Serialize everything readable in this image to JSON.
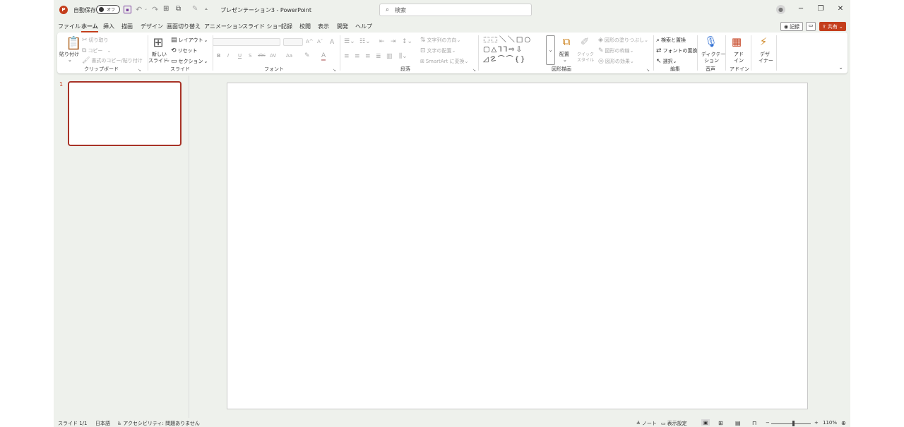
{
  "titlebar": {
    "autosave_label": "自動保存",
    "autosave_state": "オフ",
    "doc_title": "プレゼンテーション3 - PowerPoint",
    "search_placeholder": "検索",
    "minimize": "─",
    "restore": "❐",
    "close": "✕"
  },
  "tabs": [
    "ファイル",
    "ホーム",
    "挿入",
    "描画",
    "デザイン",
    "画面切り替え",
    "アニメーション",
    "スライド ショー",
    "記録",
    "校閲",
    "表示",
    "開発",
    "ヘルプ"
  ],
  "active_tab": "ホーム",
  "header_actions": {
    "record": "記録",
    "share": "共有"
  },
  "ribbon": {
    "clipboard": {
      "paste": "貼り付け",
      "cut": "切り取り",
      "copy": "コピー",
      "format_painter": "書式のコピー/貼り付け",
      "label": "クリップボード"
    },
    "slides": {
      "new_slide_line1": "新しい",
      "new_slide_line2": "スライド",
      "layout": "レイアウト",
      "reset": "リセット",
      "section": "セクション",
      "label": "スライド"
    },
    "font": {
      "bold": "B",
      "italic": "I",
      "underline": "U",
      "strike": "S",
      "shadow": "abc",
      "spacing": "AV",
      "case": "Aa",
      "grow": "A^",
      "shrink": "Aˇ",
      "clear": "A",
      "label": "フォント"
    },
    "paragraph": {
      "text_direction": "文字列の方向",
      "align_text": "文字の配置",
      "smartart": "SmartArt に変換",
      "label": "段落"
    },
    "drawing": {
      "shapes_row1": "⬚⬚＼＼□○",
      "shapes_row2": "▢△⅂⅂⇨⇩",
      "shapes_row3": "◿☡⌒⌒{}",
      "arrange": "配置",
      "quick_styles_line1": "クイック",
      "quick_styles_line2": "スタイル",
      "shape_fill": "図形の塗りつぶし",
      "shape_outline": "図形の枠線",
      "shape_effects": "図形の効果",
      "label": "図形描画"
    },
    "editing": {
      "find": "検索と置換",
      "replace_fonts": "フォントの置換",
      "select": "選択",
      "label": "編集"
    },
    "voice": {
      "dictate_line1": "ディクテー",
      "dictate_line2": "ション",
      "label": "音声"
    },
    "addins": {
      "addins_line1": "アド",
      "addins_line2": "イン",
      "label": "アドイン"
    },
    "designer": {
      "line1": "デザ",
      "line2": "イナー"
    }
  },
  "thumbnails": {
    "slide_number": "1"
  },
  "statusbar": {
    "slide_pos": "スライド 1/1",
    "language": "日本語",
    "accessibility": "アクセシビリティ: 問題ありません",
    "notes": "ノート",
    "display_settings": "表示設定",
    "zoom_minus": "−",
    "zoom_plus": "+",
    "zoom_level": "110%"
  },
  "colors": {
    "accent": "#c43e1c",
    "selection": "#a83226",
    "background": "#eef1ec"
  }
}
